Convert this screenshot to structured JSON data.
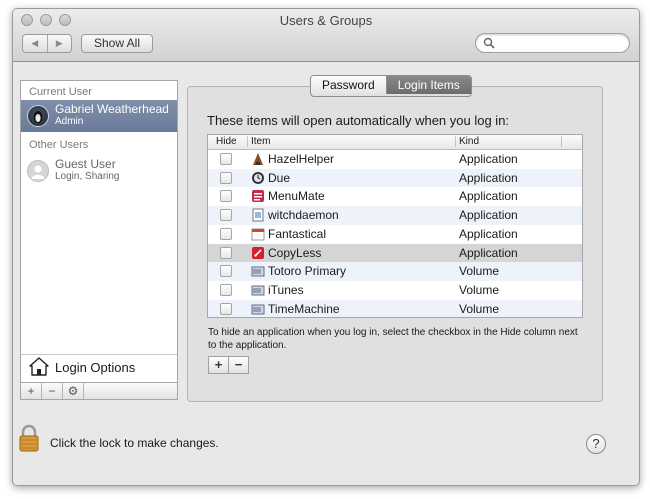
{
  "window": {
    "title": "Users & Groups"
  },
  "toolbar": {
    "back_label": "◀",
    "forward_label": "▶",
    "show_all_label": "Show All",
    "search_placeholder": ""
  },
  "sidebar": {
    "current_user_heading": "Current User",
    "current_user": {
      "name": "Gabriel Weatherhead",
      "role": "Admin"
    },
    "other_users_heading": "Other Users",
    "guest_user": {
      "name": "Guest User",
      "detail": "Login, Sharing"
    },
    "login_options_label": "Login Options",
    "add_label": "+",
    "remove_label": "−",
    "action_label": "⚙"
  },
  "tabs": {
    "password_label": "Password",
    "login_items_label": "Login Items"
  },
  "login_items": {
    "intro": "These items will open automatically when you log in:",
    "columns": {
      "hide": "Hide",
      "item": "Item",
      "kind": "Kind"
    },
    "rows": [
      {
        "name": "HazelHelper",
        "kind": "Application",
        "icon": "hazel-icon"
      },
      {
        "name": "Due",
        "kind": "Application",
        "icon": "due-icon"
      },
      {
        "name": "MenuMate",
        "kind": "Application",
        "icon": "menumate-icon"
      },
      {
        "name": "witchdaemon",
        "kind": "Application",
        "icon": "witch-icon"
      },
      {
        "name": "Fantastical",
        "kind": "Application",
        "icon": "calendar-icon"
      },
      {
        "name": "CopyLess",
        "kind": "Application",
        "icon": "copyless-icon"
      },
      {
        "name": "Totoro Primary",
        "kind": "Volume",
        "icon": "drive-icon"
      },
      {
        "name": "iTunes",
        "kind": "Volume",
        "icon": "drive-icon"
      },
      {
        "name": "TimeMachine",
        "kind": "Volume",
        "icon": "drive-icon"
      }
    ],
    "hint": "To hide an application when you log in, select the checkbox in the Hide column next to the application.",
    "add_label": "+",
    "remove_label": "−"
  },
  "footer": {
    "lock_text": "Click the lock to make changes.",
    "help_label": "?"
  }
}
